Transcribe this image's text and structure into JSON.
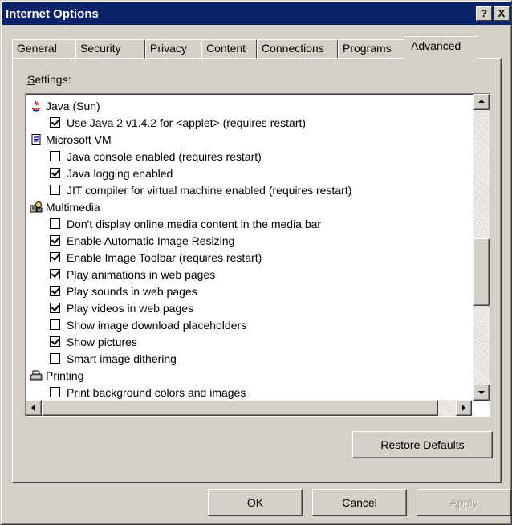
{
  "window": {
    "title": "Internet Options",
    "help_btn": "?",
    "close_btn": "X"
  },
  "tabs": [
    "General",
    "Security",
    "Privacy",
    "Content",
    "Connections",
    "Programs",
    "Advanced"
  ],
  "active_tab": "Advanced",
  "settings": {
    "label_mnemonic": "S",
    "label_rest": "ettings:"
  },
  "list": [
    {
      "type": "category",
      "icon": "java-icon",
      "label": "Java (Sun)"
    },
    {
      "type": "option",
      "checked": true,
      "label": "Use Java 2 v1.4.2 for <applet> (requires restart)"
    },
    {
      "type": "category",
      "icon": "document-icon",
      "label": "Microsoft VM"
    },
    {
      "type": "option",
      "checked": false,
      "label": "Java console enabled (requires restart)"
    },
    {
      "type": "option",
      "checked": true,
      "label": "Java logging enabled"
    },
    {
      "type": "option",
      "checked": false,
      "label": "JIT compiler for virtual machine enabled (requires restart)"
    },
    {
      "type": "category",
      "icon": "multimedia-icon",
      "label": "Multimedia"
    },
    {
      "type": "option",
      "checked": false,
      "label": "Don't display online media content in the media bar"
    },
    {
      "type": "option",
      "checked": true,
      "label": "Enable Automatic Image Resizing"
    },
    {
      "type": "option",
      "checked": true,
      "label": "Enable Image Toolbar (requires restart)"
    },
    {
      "type": "option",
      "checked": true,
      "label": "Play animations in web pages"
    },
    {
      "type": "option",
      "checked": true,
      "label": "Play sounds in web pages"
    },
    {
      "type": "option",
      "checked": true,
      "label": "Play videos in web pages"
    },
    {
      "type": "option",
      "checked": false,
      "label": "Show image download placeholders"
    },
    {
      "type": "option",
      "checked": true,
      "label": "Show pictures"
    },
    {
      "type": "option",
      "checked": false,
      "label": "Smart image dithering"
    },
    {
      "type": "category",
      "icon": "printer-icon",
      "label": "Printing"
    },
    {
      "type": "option",
      "checked": false,
      "label": "Print background colors and images"
    }
  ],
  "buttons": {
    "restore_mnemonic": "R",
    "restore_rest": "estore Defaults",
    "ok": "OK",
    "cancel": "Cancel",
    "apply": "Apply"
  }
}
